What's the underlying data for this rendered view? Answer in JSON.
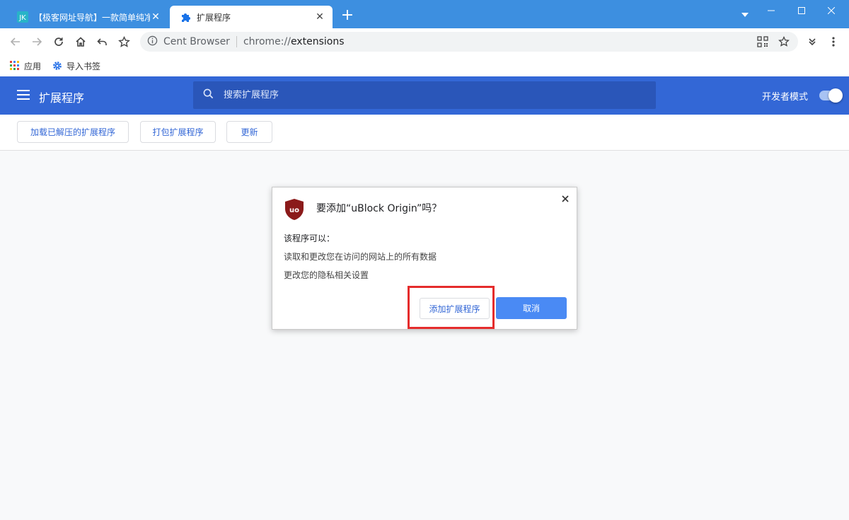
{
  "tabs": [
    {
      "title": "【极客网址导航】一款简单纯净的",
      "favicon": "JK",
      "active": false
    },
    {
      "title": "扩展程序",
      "favicon": "puzzle-icon",
      "active": true
    }
  ],
  "new_tab_label": "+",
  "omnibox": {
    "site_name": "Cent Browser",
    "url_scheme": "chrome://",
    "url_path": "extensions"
  },
  "bookmarks": [
    {
      "label": "应用",
      "icon": "apps-grid-icon"
    },
    {
      "label": "导入书签",
      "icon": "gear-icon"
    }
  ],
  "extensions_page": {
    "title": "扩展程序",
    "search_placeholder": "搜索扩展程序",
    "dev_mode_label": "开发者模式",
    "dev_mode_enabled": true,
    "actions": [
      "加载已解压的扩展程序",
      "打包扩展程序",
      "更新"
    ]
  },
  "dialog": {
    "title": "要添加“uBlock Origin”吗？",
    "permissions_header": "该程序可以：",
    "permissions": [
      "读取和更改您在访问的网站上的所有数据",
      "更改您的隐私相关设置"
    ],
    "add_button": "添加扩展程序",
    "cancel_button": "取消",
    "icon_text": "uo"
  },
  "colors": {
    "tabstrip": "#3d8fe0",
    "header": "#3367d6",
    "primary_button": "#4a8af4",
    "highlight": "#e52c2c",
    "ublock_red": "#8b1a1a"
  }
}
